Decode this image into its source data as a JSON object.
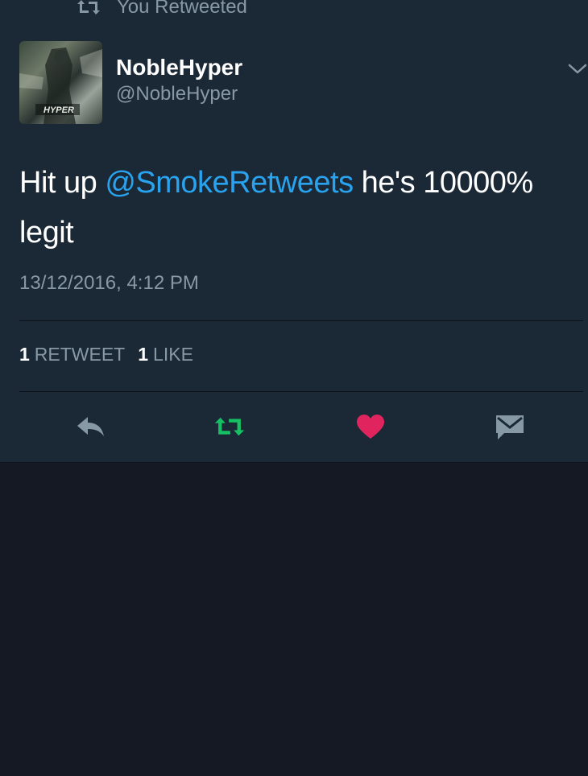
{
  "retweet_context": {
    "label": "You Retweeted",
    "icon": "retweet-icon"
  },
  "author": {
    "display_name": "NobleHyper",
    "handle": "@NobleHyper",
    "avatar_text": "HYPER"
  },
  "tweet": {
    "text_before": "Hit up ",
    "mention": "@SmokeRetweets",
    "text_after": " he's 10000% legit",
    "timestamp": "13/12/2016, 4:12 PM"
  },
  "stats": {
    "retweets_count": "1",
    "retweets_label": "RETWEET",
    "likes_count": "1",
    "likes_label": "LIKE"
  },
  "actions": {
    "reply_icon": "reply-icon",
    "retweet_icon": "retweet-icon",
    "like_icon": "heart-icon",
    "dm_icon": "envelope-icon"
  },
  "colors": {
    "card_bg": "#1b2836",
    "page_bg": "#141923",
    "secondary_text": "#8899a6",
    "mention": "#2aa3ef",
    "retweet_active": "#17bf63",
    "like_active": "#e0245e"
  }
}
